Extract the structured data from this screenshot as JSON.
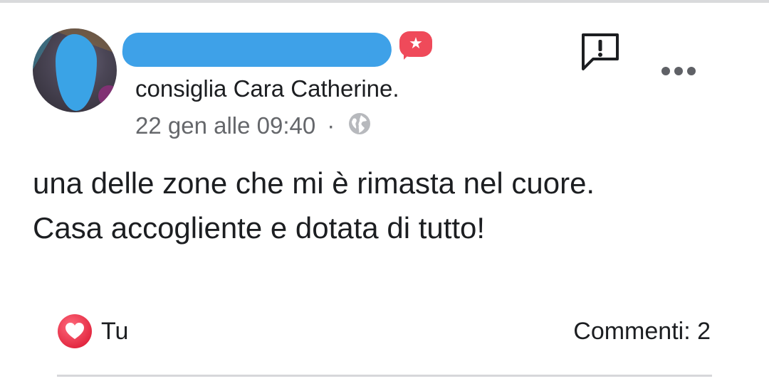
{
  "post": {
    "recommendation_verb": "consiglia",
    "page_name": "Cara Catherine.",
    "timestamp": "22 gen alle 09:40",
    "separator": "·",
    "body_lines": [
      "una delle zone che mi è rimasta nel cuore.",
      "Casa accogliente e dotata di tutto!"
    ],
    "reactions_by": "Tu",
    "comments_label": "Commenti: 2"
  },
  "icons": {
    "recommend_badge": "star-speech-bubble-icon",
    "report": "report-exclamation-icon",
    "more": "more-options-icon",
    "audience": "globe-icon",
    "reaction": "heart-reaction-icon"
  },
  "colors": {
    "badge_red": "#ef4a5a",
    "heart_red": "#e8334a",
    "redaction_blue": "#3ea1e8",
    "secondary_text": "#65676b"
  }
}
